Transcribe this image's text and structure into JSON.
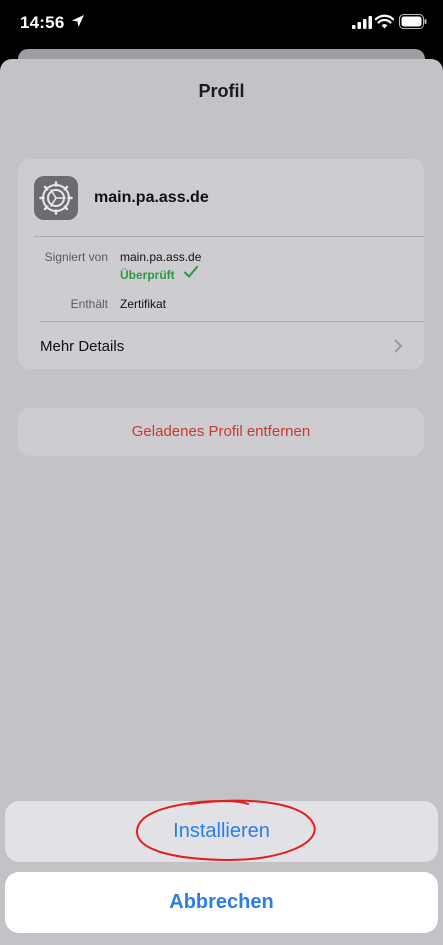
{
  "status_bar": {
    "time": "14:56"
  },
  "sheet": {
    "title": "Profil"
  },
  "profile": {
    "name": "main.pa.ass.de",
    "signed_by_label": "Signiert von",
    "signed_by_value": "main.pa.ass.de",
    "verified_text": "Überprüft",
    "contains_label": "Enthält",
    "contains_value": "Zertifikat",
    "more_details_label": "Mehr Details"
  },
  "remove_button": {
    "label": "Geladenes Profil entfernen"
  },
  "action_sheet": {
    "install_label": "Installieren",
    "cancel_label": "Abbrechen"
  },
  "colors": {
    "accent": "#2a7ee6",
    "destructive": "#c9392c",
    "verified": "#2a9b3b",
    "annotation": "#e02020"
  },
  "icons": {
    "status": [
      "location-arrow-icon",
      "cellular-signal-icon",
      "wifi-icon",
      "battery-icon"
    ],
    "profile": "settings-gear-icon",
    "verified": "checkmark-icon",
    "more_details": "chevron-right-icon"
  }
}
